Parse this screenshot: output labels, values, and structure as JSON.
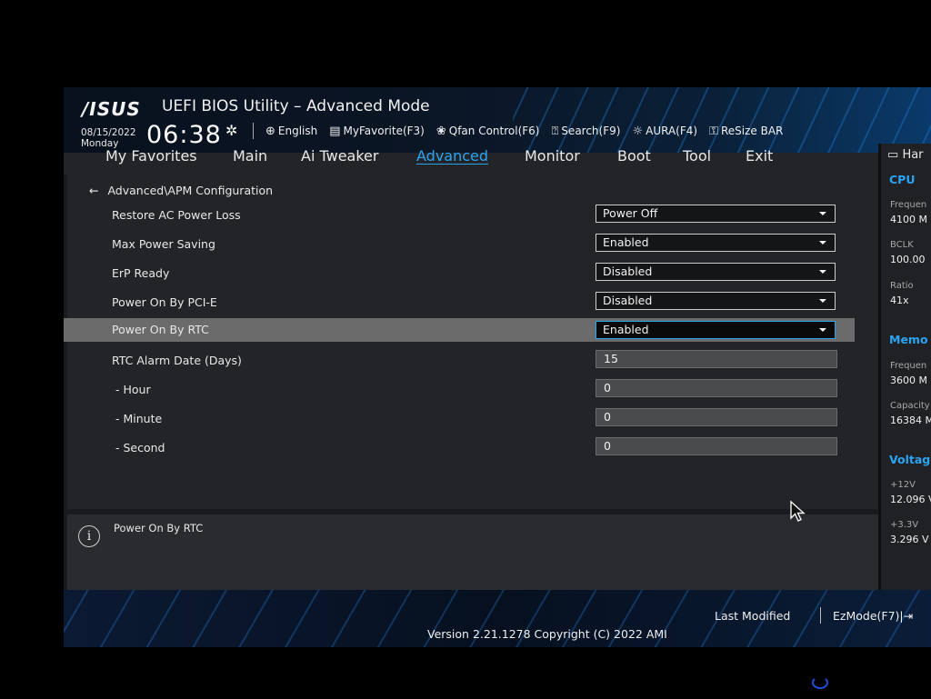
{
  "header": {
    "logo": "/ISUS",
    "title": "UEFI BIOS Utility – Advanced Mode",
    "date": "08/15/2022",
    "day": "Monday",
    "time": "06:38",
    "toolbar": [
      {
        "label": "English",
        "icon": "globe-icon"
      },
      {
        "label": "MyFavorite(F3)",
        "icon": "favorite-icon"
      },
      {
        "label": "Qfan Control(F6)",
        "icon": "fan-icon"
      },
      {
        "label": "Search(F9)",
        "icon": "search-icon"
      },
      {
        "label": "AURA(F4)",
        "icon": "aura-icon"
      },
      {
        "label": "ReSize BAR",
        "icon": "resize-bar-icon"
      }
    ]
  },
  "tabs": [
    "My Favorites",
    "Main",
    "Ai Tweaker",
    "Advanced",
    "Monitor",
    "Boot",
    "Tool",
    "Exit"
  ],
  "active_tab": "Advanced",
  "breadcrumb": "Advanced\\APM Configuration",
  "settings": [
    {
      "label": "Restore AC Power Loss",
      "value": "Power Off",
      "type": "dropdown"
    },
    {
      "label": "Max Power Saving",
      "value": "Enabled",
      "type": "dropdown"
    },
    {
      "label": "ErP Ready",
      "value": "Disabled",
      "type": "dropdown"
    },
    {
      "label": "Power On By PCI-E",
      "value": "Disabled",
      "type": "dropdown"
    },
    {
      "label": "Power On By RTC",
      "value": "Enabled",
      "type": "dropdown",
      "selected": true
    },
    {
      "label": "RTC Alarm Date (Days)",
      "value": "15",
      "type": "number"
    },
    {
      "label": "- Hour",
      "value": "0",
      "type": "number"
    },
    {
      "label": "- Minute",
      "value": "0",
      "type": "number"
    },
    {
      "label": "- Second",
      "value": "0",
      "type": "number"
    }
  ],
  "help_text": "Power On By RTC",
  "footer": {
    "version": "Version 2.21.1278 Copyright (C) 2022 AMI",
    "last_modified": "Last Modified",
    "ezmode": "EzMode(F7)|"
  },
  "right_panel": {
    "title": "Har",
    "cpu": {
      "section": "CPU",
      "freq_label": "Frequen",
      "freq_value": "4100 M",
      "bclk_label": "BCLK",
      "bclk_value": "100.00",
      "ratio_label": "Ratio",
      "ratio_value": "41x"
    },
    "memory": {
      "section": "Memo",
      "freq_label": "Frequen",
      "freq_value": "3600 M",
      "cap_label": "Capacity",
      "cap_value": "16384 M"
    },
    "voltage": {
      "section": "Voltag",
      "v12_label": "+12V",
      "v12_value": "12.096 V",
      "v33_label": "+3.3V",
      "v33_value": "3.296 V"
    }
  },
  "colors": {
    "accent": "#2aa4f4",
    "background": "#232428",
    "selected_row": "#6b6b6b"
  }
}
